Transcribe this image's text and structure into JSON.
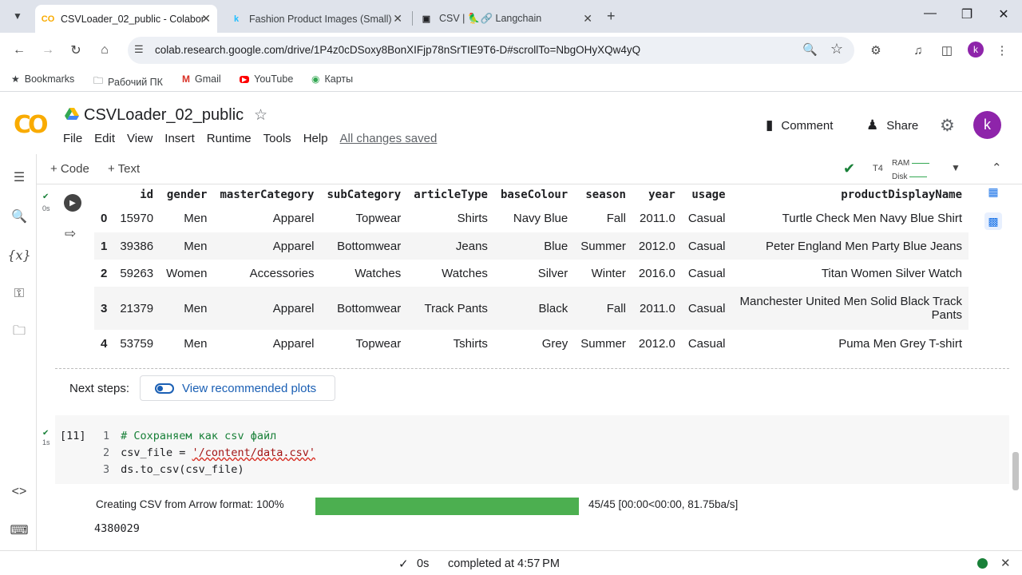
{
  "browser": {
    "tabs": [
      {
        "title": "CSVLoader_02_public - Colabor",
        "fav": "CO",
        "active": true
      },
      {
        "title": "Fashion Product Images (Small)",
        "fav": "k",
        "active": false
      },
      {
        "title": "CSV | 🦜🔗 Langchain",
        "fav": "▣",
        "active": false
      }
    ],
    "url": "colab.research.google.com/drive/1P4z0cDSoxy8BonXIFjp78nSrTIE9T6-D#scrollTo=NbgOHyXQw4yQ",
    "profile_initial": "k",
    "bookmarks": [
      {
        "label": "Bookmarks",
        "icon": "star-icon"
      },
      {
        "label": "Рабочий ПК",
        "icon": "folder-icon"
      },
      {
        "label": "Gmail",
        "icon": "gmail-icon"
      },
      {
        "label": "YouTube",
        "icon": "youtube-icon"
      },
      {
        "label": "Карты",
        "icon": "maps-icon"
      }
    ]
  },
  "colab": {
    "logo": "CO",
    "title": "CSVLoader_02_public",
    "menu": [
      "File",
      "Edit",
      "View",
      "Insert",
      "Runtime",
      "Tools",
      "Help"
    ],
    "saved_status": "All changes saved",
    "comment_label": "Comment",
    "share_label": "Share",
    "account_initial": "k",
    "toolbar": {
      "add_code": "+ Code",
      "add_text": "+ Text",
      "runtime_type": "T4",
      "ram_label": "RAM",
      "disk_label": "Disk"
    }
  },
  "dataframe": {
    "columns": [
      "",
      "id",
      "gender",
      "masterCategory",
      "subCategory",
      "articleType",
      "baseColour",
      "season",
      "year",
      "usage",
      "productDisplayName"
    ],
    "rows": [
      [
        "0",
        "15970",
        "Men",
        "Apparel",
        "Topwear",
        "Shirts",
        "Navy Blue",
        "Fall",
        "2011.0",
        "Casual",
        "Turtle Check Men Navy Blue Shirt"
      ],
      [
        "1",
        "39386",
        "Men",
        "Apparel",
        "Bottomwear",
        "Jeans",
        "Blue",
        "Summer",
        "2012.0",
        "Casual",
        "Peter England Men Party Blue Jeans"
      ],
      [
        "2",
        "59263",
        "Women",
        "Accessories",
        "Watches",
        "Watches",
        "Silver",
        "Winter",
        "2016.0",
        "Casual",
        "Titan Women Silver Watch"
      ],
      [
        "3",
        "21379",
        "Men",
        "Apparel",
        "Bottomwear",
        "Track Pants",
        "Black",
        "Fall",
        "2011.0",
        "Casual",
        "Manchester United Men Solid Black Track Pants"
      ],
      [
        "4",
        "53759",
        "Men",
        "Apparel",
        "Topwear",
        "Tshirts",
        "Grey",
        "Summer",
        "2012.0",
        "Casual",
        "Puma Men Grey T-shirt"
      ]
    ],
    "exec_time": "0s"
  },
  "next_steps": {
    "label": "Next steps:",
    "button": "View recommended plots"
  },
  "code_cell": {
    "prompt": "[11]",
    "exec_time": "1s",
    "lines": [
      {
        "n": "1",
        "comment": "# Сохраняем как csv файл"
      },
      {
        "n": "2",
        "pre": "csv_file = ",
        "str": "'/content/data.csv'"
      },
      {
        "n": "3",
        "pre": "ds.to_csv(csv_file)"
      }
    ],
    "progress_label": "Creating CSV from Arrow format: 100%",
    "progress_fraction": 1.0,
    "progress_stats": "45/45 [00:00<00:00, 81.75ba/s]",
    "output": "4380029"
  },
  "status": {
    "time": "0s",
    "text": "completed at 4:57 PM"
  },
  "colors": {
    "accent": "#1a73e8",
    "success": "#188038",
    "progress": "#4caf50",
    "avatar": "#8e24aa",
    "logo": "#f9ab00"
  }
}
